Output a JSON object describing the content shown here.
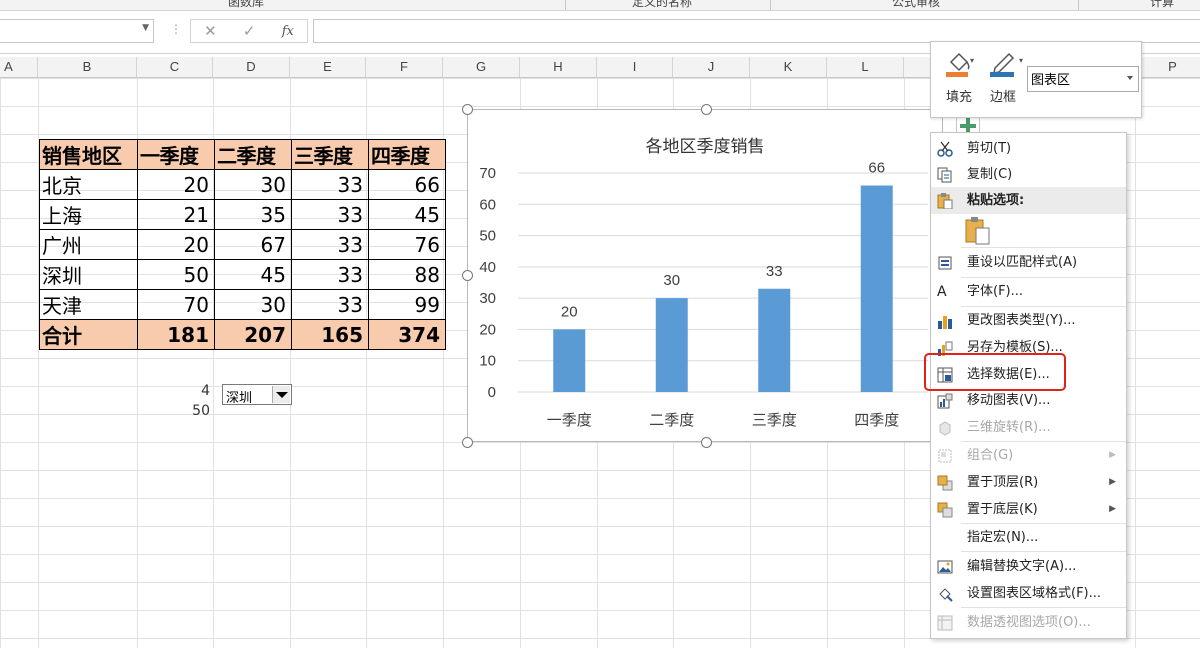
{
  "ribbon": {
    "group_labels": [
      "函数库",
      "定义的名称",
      "公式审核",
      "计算"
    ]
  },
  "formula_bar": {
    "name_box": "",
    "cancel_icon": "close-icon",
    "enter_icon": "check-icon",
    "fx_label": "fx",
    "formula": ""
  },
  "columns": [
    "A",
    "B",
    "C",
    "D",
    "E",
    "F",
    "G",
    "H",
    "I",
    "J",
    "K",
    "L",
    "P"
  ],
  "table": {
    "headers": [
      "销售地区",
      "一季度",
      "二季度",
      "三季度",
      "四季度"
    ],
    "rows": [
      [
        "北京",
        "20",
        "30",
        "33",
        "66"
      ],
      [
        "上海",
        "21",
        "35",
        "33",
        "45"
      ],
      [
        "广州",
        "20",
        "67",
        "33",
        "76"
      ],
      [
        "深圳",
        "50",
        "45",
        "33",
        "88"
      ],
      [
        "天津",
        "70",
        "30",
        "33",
        "99"
      ]
    ],
    "total": [
      "合计",
      "181",
      "207",
      "165",
      "374"
    ]
  },
  "aux": {
    "index_value": "4",
    "selected_value": "50",
    "combo_selected": "深圳"
  },
  "chart_data": {
    "type": "bar",
    "title": "各地区季度销售",
    "categories": [
      "一季度",
      "二季度",
      "三季度",
      "四季度"
    ],
    "values": [
      20,
      30,
      33,
      66
    ],
    "ylim": [
      0,
      70
    ],
    "yticks": [
      0,
      10,
      20,
      30,
      40,
      50,
      60,
      70
    ],
    "xlabel": "",
    "ylabel": "",
    "grid": true,
    "bar_color": "#5b9bd5",
    "data_labels": true
  },
  "mini_toolbar": {
    "fill_label": "填充",
    "border_label": "边框",
    "element_select": "图表区"
  },
  "context_menu": {
    "cut": "剪切(T)",
    "copy": "复制(C)",
    "paste_options": "粘贴选项:",
    "reset_style": "重设以匹配样式(A)",
    "font": "字体(F)...",
    "change_type": "更改图表类型(Y)...",
    "save_template": "另存为模板(S)...",
    "select_data": "选择数据(E)...",
    "move_chart": "移动图表(V)...",
    "rotate_3d": "三维旋转(R)...",
    "group": "组合(G)",
    "bring_front": "置于顶层(R)",
    "send_back": "置于底层(K)",
    "assign_macro": "指定宏(N)...",
    "edit_alt_text": "编辑替换文字(A)...",
    "format_area": "设置图表区域格式(F)...",
    "pivot_options": "数据透视图选项(O)..."
  },
  "colors": {
    "header_fill": "#f8cbad",
    "bar": "#5b9bd5",
    "highlight": "#e0221a",
    "fill_accent": "#ed7d31",
    "border_accent": "#2e75b6"
  }
}
